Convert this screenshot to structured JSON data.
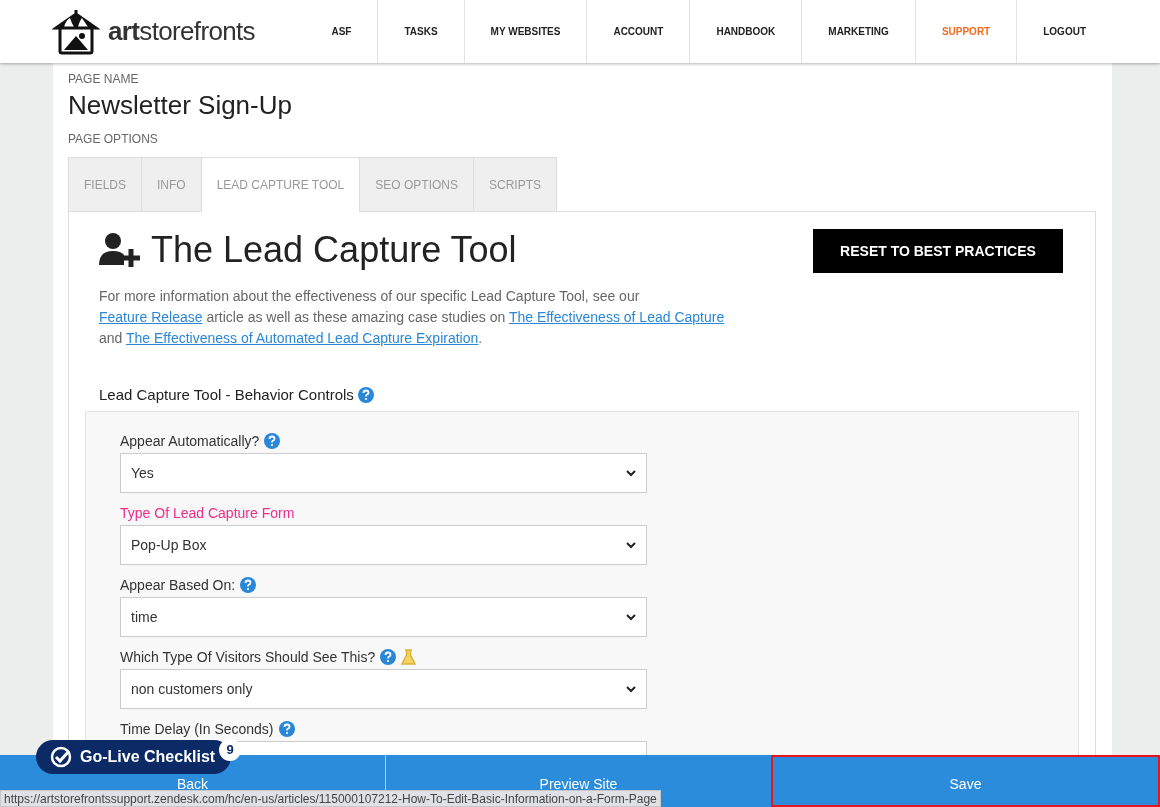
{
  "header": {
    "logo_text_bold": "art",
    "logo_text": "storefronts",
    "nav": [
      {
        "label": "ASF",
        "selected": false
      },
      {
        "label": "TASKS",
        "selected": false
      },
      {
        "label": "MY WEBSITES",
        "selected": false
      },
      {
        "label": "ACCOUNT",
        "selected": false
      },
      {
        "label": "HANDBOOK",
        "selected": false
      },
      {
        "label": "MARKETING",
        "selected": false
      },
      {
        "label": "SUPPORT",
        "selected": true
      },
      {
        "label": "LOGOUT",
        "selected": false
      }
    ]
  },
  "page_name_label": "PAGE NAME",
  "page_name": "Newsletter Sign-Up",
  "page_options_label": "PAGE OPTIONS",
  "tabs": [
    {
      "label": "FIELDS",
      "selected": false
    },
    {
      "label": "INFO",
      "selected": false
    },
    {
      "label": "LEAD CAPTURE TOOL",
      "selected": true
    },
    {
      "label": "SEO OPTIONS",
      "selected": false
    },
    {
      "label": "SCRIPTS",
      "selected": false
    }
  ],
  "tool": {
    "title": "The Lead Capture Tool",
    "reset_button": "RESET TO BEST PRACTICES",
    "intro": [
      {
        "text": "For more information about the effectiveness of our specific Lead Capture Tool, see our ",
        "link": false
      },
      {
        "text": "Feature Release",
        "link": true
      },
      {
        "text": " article as well as these amazing case studies on ",
        "link": false
      },
      {
        "text": "The Effectiveness of Lead Capture",
        "link": true
      },
      {
        "text": " and ",
        "link": false
      },
      {
        "text": "The Effectiveness of Automated Lead Capture Expiration",
        "link": true
      },
      {
        "text": ".",
        "link": false
      }
    ],
    "section_title": "Lead Capture Tool - Behavior Controls",
    "section_help": true,
    "fields": [
      {
        "label": "Appear Automatically?",
        "highlighted": false,
        "help": true,
        "experimental": false,
        "value": "Yes"
      },
      {
        "label": "Type Of Lead Capture Form",
        "highlighted": true,
        "help": false,
        "experimental": false,
        "value": "Pop-Up Box"
      },
      {
        "label": "Appear Based On:",
        "highlighted": false,
        "help": true,
        "experimental": false,
        "value": "time"
      },
      {
        "label": "Which Type Of Visitors Should See This?",
        "highlighted": false,
        "help": true,
        "experimental": true,
        "value": "non customers only"
      },
      {
        "label": "Time Delay (In Seconds)",
        "highlighted": false,
        "help": true,
        "experimental": false
      }
    ]
  },
  "checklist": {
    "label": "Go-Live Checklist",
    "count": "9"
  },
  "footer_buttons": [
    {
      "label": "Back",
      "selected": false
    },
    {
      "label": "Preview Site",
      "selected": false
    },
    {
      "label": "Save",
      "selected": true
    }
  ],
  "status_url": "https://artstorefrontssupport.zendesk.com/hc/en-us/articles/115000107212-How-To-Edit-Basic-Information-on-a-Form-Page"
}
